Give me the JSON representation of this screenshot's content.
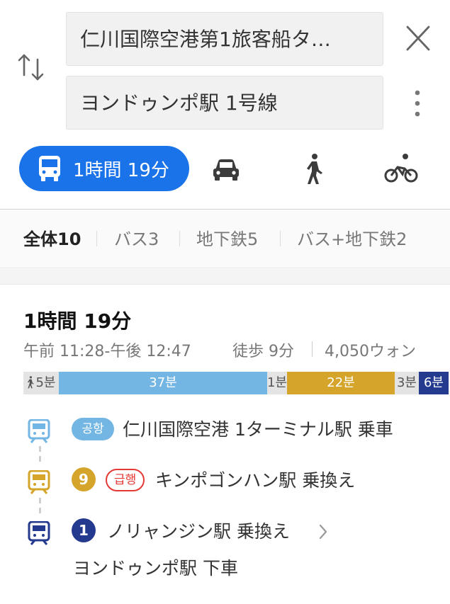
{
  "route_inputs": {
    "origin": "仁川国際空港第1旅客船タ…",
    "destination": "ヨンドゥンポ駅 1号線"
  },
  "modes": {
    "transit_label": "1時間 19分"
  },
  "filters": {
    "all": "全体10",
    "bus": "バス3",
    "subway": "地下鉄5",
    "bus_subway": "バス+地下鉄2"
  },
  "route": {
    "duration": "1時間 19分",
    "time_range": "午前 11:28-午後 12:47",
    "walk": "徒歩 9分",
    "fare": "4,050ウォン",
    "segments": [
      {
        "label": "5분",
        "minutes": 5,
        "type": "walk"
      },
      {
        "label": "37분",
        "minutes": 37,
        "type": "airport"
      },
      {
        "label": "1분",
        "minutes": 1,
        "type": "transfer"
      },
      {
        "label": "22분",
        "minutes": 22,
        "type": "line9"
      },
      {
        "label": "3분",
        "minutes": 3,
        "type": "transfer"
      },
      {
        "label": "6분",
        "minutes": 6,
        "type": "line1"
      }
    ],
    "steps": [
      {
        "badge": "공항",
        "text": "仁川国際空港 1ターミナル駅 乗車"
      },
      {
        "badge": "9",
        "express": "급행",
        "text": "キンポゴンハン駅 乗換え"
      },
      {
        "badge": "1",
        "text": "ノリャンジン駅 乗換え"
      }
    ],
    "alight": "ヨンドゥンポ駅 下車"
  },
  "colors": {
    "accent": "#1a73e8",
    "airport_line": "#73b6e4",
    "line9": "#d4a52a",
    "line1": "#243a8f",
    "express": "#e53935",
    "transfer": "#e4e4e4"
  }
}
